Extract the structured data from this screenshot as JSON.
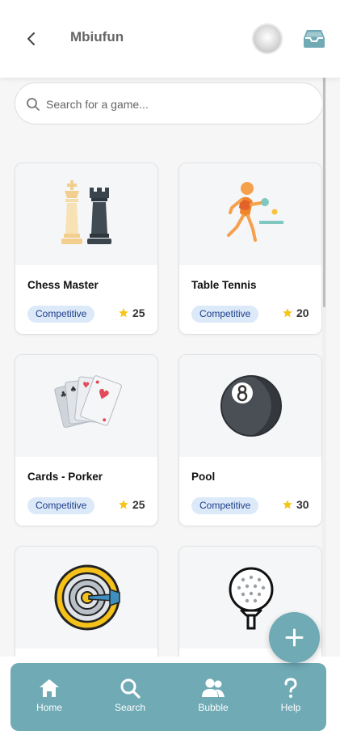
{
  "header": {
    "title": "Mbiufun"
  },
  "search": {
    "placeholder": "Search for a game..."
  },
  "games": [
    {
      "title": "Chess Master",
      "tag": "Competitive",
      "rating": "25",
      "icon": "chess-icon"
    },
    {
      "title": "Table Tennis",
      "tag": "Competitive",
      "rating": "20",
      "icon": "table-tennis-icon"
    },
    {
      "title": "Cards - Porker",
      "tag": "Competitive",
      "rating": "25",
      "icon": "playing-cards-icon"
    },
    {
      "title": "Pool",
      "tag": "Competitive",
      "rating": "30",
      "icon": "eight-ball-icon"
    },
    {
      "title": "",
      "tag": "",
      "rating": "",
      "icon": "dartboard-icon"
    },
    {
      "title": "",
      "tag": "",
      "rating": "",
      "icon": "golf-ball-icon"
    }
  ],
  "nav": {
    "items": [
      {
        "label": "Home",
        "icon": "home-icon"
      },
      {
        "label": "Search",
        "icon": "search-icon"
      },
      {
        "label": "Bubble",
        "icon": "users-icon"
      },
      {
        "label": "Help",
        "icon": "help-icon"
      }
    ]
  },
  "colors": {
    "accent": "#6faab5",
    "badge_bg": "#dce9f8",
    "badge_text": "#1f3f8a",
    "star": "#f5c518"
  }
}
